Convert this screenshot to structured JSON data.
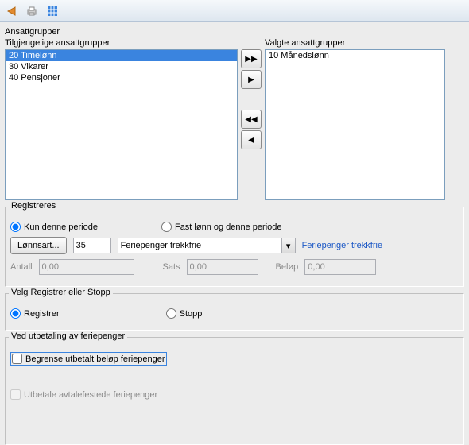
{
  "toolbar": {
    "icon1": "arrow",
    "icon2": "print",
    "icon3": "grid"
  },
  "groups": {
    "title": "Ansattgrupper",
    "available_label": "Tilgjengelige ansattgrupper",
    "selected_label": "Valgte ansattgrupper",
    "available": [
      "20 Timelønn",
      "30 Vikarer",
      "40 Pensjoner"
    ],
    "available_selected_index": 0,
    "selected": [
      "10 Månedslønn"
    ]
  },
  "register": {
    "title": "Registreres",
    "radio_this_period": "Kun denne periode",
    "radio_fixed": "Fast lønn og denne periode",
    "lonnsart_btn": "Lønnsart...",
    "lonnsart_code": "35",
    "lonnsart_combo": "Feriepenger trekkfrie",
    "link": "Feriepenger trekkfrie",
    "antall_label": "Antall",
    "antall_value": "0,00",
    "sats_label": "Sats",
    "sats_value": "0,00",
    "belop_label": "Beløp",
    "belop_value": "0,00"
  },
  "action": {
    "title": "Velg Registrer eller Stopp",
    "radio_register": "Registrer",
    "radio_stop": "Stopp"
  },
  "payout": {
    "title": "Ved utbetaling av feriepenger",
    "limit_label": "Begrense utbetalt beløp feriepenger",
    "contractual_label": "Utbetale avtalefestede feriepenger"
  }
}
